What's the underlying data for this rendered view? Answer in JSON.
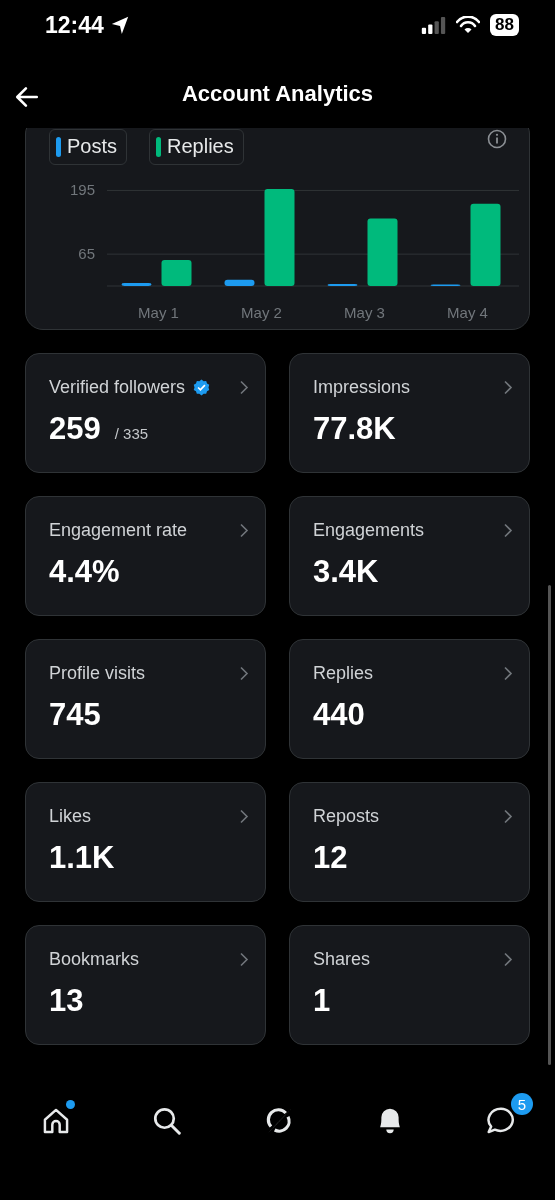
{
  "status_bar": {
    "time": "12:44",
    "battery": "88"
  },
  "header": {
    "title": "Account Analytics"
  },
  "chart": {
    "chart_data": {
      "type": "bar",
      "categories": [
        "May 1",
        "May 2",
        "May 3",
        "May 4"
      ],
      "series": [
        {
          "name": "Posts",
          "color": "#1d9bf0",
          "values": [
            6,
            13,
            4,
            3
          ]
        },
        {
          "name": "Replies",
          "color": "#00ba7c",
          "values": [
            53,
            198,
            138,
            168
          ]
        }
      ],
      "ylim": [
        0,
        200
      ],
      "yticks": [
        65,
        195
      ]
    }
  },
  "metrics": [
    {
      "label": "Verified followers",
      "value": "259",
      "total": "/ 335",
      "verified": true
    },
    {
      "label": "Impressions",
      "value": "77.8K",
      "verified": false
    },
    {
      "label": "Engagement rate",
      "value": "4.4%",
      "verified": false
    },
    {
      "label": "Engagements",
      "value": "3.4K",
      "verified": false
    },
    {
      "label": "Profile visits",
      "value": "745",
      "verified": false
    },
    {
      "label": "Replies",
      "value": "440",
      "verified": false
    },
    {
      "label": "Likes",
      "value": "1.1K",
      "verified": false
    },
    {
      "label": "Reposts",
      "value": "12",
      "verified": false
    },
    {
      "label": "Bookmarks",
      "value": "13",
      "verified": false
    },
    {
      "label": "Shares",
      "value": "1",
      "verified": false
    }
  ],
  "nav": [
    {
      "kind": "home",
      "dot": true
    },
    {
      "kind": "search"
    },
    {
      "kind": "grok"
    },
    {
      "kind": "bell"
    },
    {
      "kind": "messages",
      "badge": "5"
    }
  ]
}
